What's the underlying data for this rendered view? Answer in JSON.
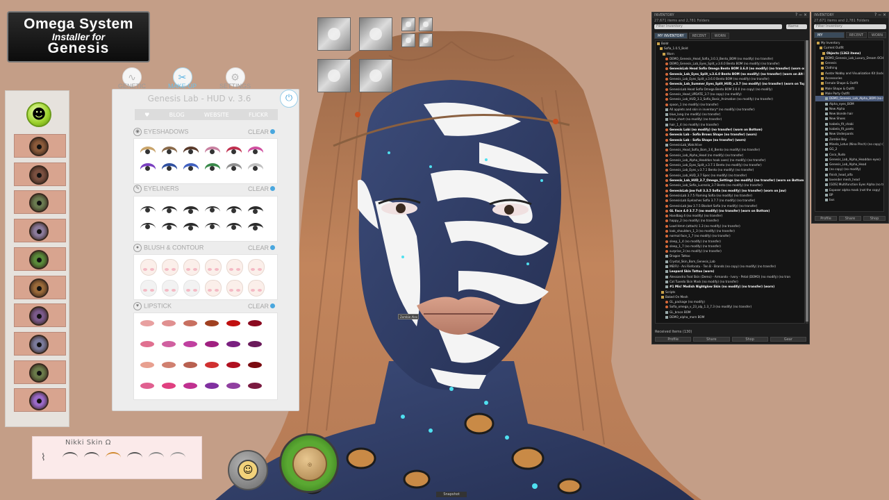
{
  "logo": {
    "line1": "Omega System",
    "line2": "Installer for",
    "line3": "Genesis"
  },
  "eye_swatches": [
    "#8a5a3a",
    "#7a5040",
    "#6a7a50",
    "#8a7a9a",
    "#5a8a3a",
    "#9a6a3a",
    "#7a5a8a",
    "#7a7a9a",
    "#6a7a4a",
    "#9a6ac8"
  ],
  "hud": {
    "tabs": [
      {
        "label": "GENETIC",
        "icon": "dna-icon",
        "glyph": "∿"
      },
      {
        "label": "MAKE-UP",
        "icon": "makeup-icon",
        "glyph": "✂"
      },
      {
        "label": "SETTINGS",
        "icon": "settings-icon",
        "glyph": "⚙"
      }
    ],
    "title": "Genesis Lab - HUD v. 3.6",
    "nav": [
      "♥",
      "BLOG",
      "WEBSITE",
      "FLICKR"
    ],
    "sections": [
      {
        "label": "EYESHADOWS",
        "clear": "CLEAR"
      },
      {
        "label": "EYELINERS",
        "clear": "CLEAR"
      },
      {
        "label": "BLUSH & CONTOUR",
        "clear": "CLEAR"
      },
      {
        "label": "LIPSTICK",
        "clear": "CLEAR"
      }
    ],
    "eyeshadow_colors": [
      "#c9a46a",
      "#8a6a4a",
      "#5a3a2a",
      "#c880a0",
      "#c03050",
      "#d050a0",
      "#7a40c0",
      "#3050a0",
      "#4060c0",
      "#3a8a4a",
      "#909090",
      "#c0c0c0"
    ],
    "lipstick_colors": [
      "#e8a0a0",
      "#e09090",
      "#c87060",
      "#a04020",
      "#c01010",
      "#8a0a20",
      "#e07090",
      "#d060a0",
      "#c040a0",
      "#a02080",
      "#7a2080",
      "#6a1a5a",
      "#e8a090",
      "#d08070",
      "#b86050",
      "#d03030",
      "#b01020",
      "#7a0a10",
      "#e06090",
      "#e04080",
      "#c03090",
      "#8030a0",
      "#9040a0",
      "#7a1a40"
    ]
  },
  "nikki": {
    "title": "Nikki Skin Ω"
  },
  "inventory_left": {
    "title": "INVENTORY",
    "count": "27,671 items and 2,781 Folders",
    "filter_placeholder": "Filter Inventory",
    "filter_option": "Name",
    "tabs": [
      "MY INVENTORY",
      "RECENT",
      "WORN"
    ],
    "items": [
      {
        "t": "Boldr",
        "k": "folder",
        "b": false
      },
      {
        "t": "Sofia_1.0.5_Bold",
        "k": "folder",
        "b": false
      },
      {
        "t": "Worn",
        "k": "folder",
        "b": false
      },
      {
        "t": "DEMO_Genesis_Head_Sofia_3.0.3_Bento_BOM (no modify) (no transfer)",
        "k": "obj",
        "b": false
      },
      {
        "t": "DEMO_Genesis_Lab_Eyes_Split_v.3.6.0 Bento BOM (no modify) (no transfer)",
        "k": "obj",
        "b": false
      },
      {
        "t": "GenesisLab Head Sofia Omega Bento BOM 3.6.0 (no modify) (no transfer) (worn on",
        "k": "obj",
        "b": true
      },
      {
        "t": "Genesis_Lab_Eyes_Split_v.3.6.0 Bento BOM (no modify) (no transfer) (worn on Alt Lef",
        "k": "obj",
        "b": true
      },
      {
        "t": "Genesis_Lab_Eyes_Split_v.3.6.0 Bento BOM (no modify) (no transfer)",
        "k": "obj",
        "b": false
      },
      {
        "t": "Genesis_Lab_Summer_Eyes_Split_HUD_v.3.7 (no modify) (no transfer) (worn on Top I",
        "k": "obj",
        "b": true
      },
      {
        "t": "GenesisLab Head Sofia Omega Bento BOM 3.6.0 (no copy) (no modify)",
        "k": "obj",
        "b": false
      },
      {
        "t": "Genesis_Head_UPDATE_3.7 (no copy) (no modify)",
        "k": "obj",
        "b": false
      },
      {
        "t": "Genesis_Lab_HUD_3.3_Sofia_Basic_Animation (no modify) (no transfer)",
        "k": "obj",
        "b": false
      },
      {
        "t": "spoon_1 (no modify) (no transfer)",
        "k": "obj",
        "b": false
      },
      {
        "t": "All applets and skin in inventory* (no modify) (no transfer)",
        "k": "cloth",
        "b": false
      },
      {
        "t": "blue_long (no modify) (no transfer)",
        "k": "cloth",
        "b": false
      },
      {
        "t": "blue_short (no modify) (no transfer)",
        "k": "cloth",
        "b": false
      },
      {
        "t": "hair_1_4 (no modify) (no transfer)",
        "k": "cloth",
        "b": false
      },
      {
        "t": "Genesis Lobi (no modify) (no transfer) (worn on Bottom)",
        "k": "obj",
        "b": true
      },
      {
        "t": "Genesis Lab - Sofia Brows Shape (no transfer) (worn)",
        "k": "obj",
        "b": true
      },
      {
        "t": "Genesis Lab - Sofia Shape (no transfer) (worn)",
        "k": "obj",
        "b": true
      },
      {
        "t": "GenesisLab_Watchlive",
        "k": "cloth",
        "b": false
      },
      {
        "t": "Genesis_Head_Sofia_Bom_3.6_Bento (no modify) (no transfer)",
        "k": "obj",
        "b": false
      },
      {
        "t": "Genesis_Lab_Alpha_Head (no modify) (no transfer)",
        "k": "obj",
        "b": false
      },
      {
        "t": "Genesis_Lab_Alpha_Headdon hook axes) (no modify) (no transfer)",
        "k": "obj",
        "b": false
      },
      {
        "t": "Genesis_Lab_Eyes_Split_v.3.7.1 Bento (no modify) (no transfer)",
        "k": "obj",
        "b": false
      },
      {
        "t": "Genesis_Lab_Eyes_v.3.7.1 Bento (no modify) (no transfer)",
        "k": "obj",
        "b": false
      },
      {
        "t": "Genesis_Lab_HUD_3.7 Spec (no modify) (no transfer)",
        "k": "obj",
        "b": false
      },
      {
        "t": "Genesis_Lab_HUD_3.7_Omega_Settings (no modify) (no transfer) (worn on Bottom R",
        "k": "obj",
        "b": true
      },
      {
        "t": "Genesis_Lab_Sofia_Lucrezia_3.7 Bento (no modify) (no transfer)",
        "k": "obj",
        "b": false
      },
      {
        "t": "GenesisLab Jaw Full 3.3.5 Sofia (no modify) (no transfer) (worn on Jaw)",
        "k": "obj",
        "b": true
      },
      {
        "t": "GenesisLab 3.7.5 Flaming Sofia (no modify) (no transfer)",
        "k": "obj",
        "b": false
      },
      {
        "t": "GenesisLab Eyelashes Sofia 3.7.7 (no modify) (no transfer)",
        "k": "obj",
        "b": false
      },
      {
        "t": "GenesisLab Jaw 3.7.5 Blocket Sofia (no modify) (no transfer)",
        "k": "obj",
        "b": false
      },
      {
        "t": "GL Face 4.0 3.7.7 (no modify) (no transfer) (worn on Bottom)",
        "k": "obj",
        "b": true
      },
      {
        "t": "Handbag 4 (no modify) (no transfer)",
        "k": "obj",
        "b": false
      },
      {
        "t": "happy_2 (no modify) (no transfer)",
        "k": "obj",
        "b": false
      },
      {
        "t": "Load Hmm (attach) 1.3 (no modify) (no transfer)",
        "k": "obj",
        "b": false
      },
      {
        "t": "look_shoulders_1_3 (no modify) (no transfer)",
        "k": "obj",
        "b": false
      },
      {
        "t": "normal face_1_7 (no modify) (no transfer)",
        "k": "obj",
        "b": false
      },
      {
        "t": "sleep_1_4 (no modify) (no transfer)",
        "k": "obj",
        "b": false
      },
      {
        "t": "sleep_1_7 (no modify) (no transfer)",
        "k": "obj",
        "b": false
      },
      {
        "t": "surprise_3 (no modify) (no transfer)",
        "k": "obj",
        "b": false
      },
      {
        "t": "Dragon Tattoo",
        "k": "cloth",
        "b": false
      },
      {
        "t": "Crystal_Skin_Bom_Genesis_Lab",
        "k": "cloth",
        "b": false
      },
      {
        "t": "MEIFU - Ani Rieforatu - Ten B - Brands (no copy) (no modify) (no transfer)",
        "k": "cloth",
        "b": false
      },
      {
        "t": "Leopard Skin Tattoo (worn)",
        "k": "cloth",
        "b": true
      },
      {
        "t": "Alessandra Feat Skin (Demo) - Armando - Ivory - Petal (DEMO) (no modify) (no tran",
        "k": "cloth",
        "b": false
      },
      {
        "t": "Cat Tuxedo Skin Mask (no modify) (no transfer)",
        "k": "cloth",
        "b": false
      },
      {
        "t": "#1 Mis! Modish Nightglow Skin (no modify) (no transfer) (worn)",
        "k": "cloth",
        "b": true
      },
      {
        "t": "Scripts",
        "k": "folder",
        "b": false
      },
      {
        "t": "Baked On Mesh",
        "k": "folder",
        "b": false
      },
      {
        "t": "GL_package (no modify)",
        "k": "obj",
        "b": false
      },
      {
        "t": "Sofia_omega_v_23_alp_1.3_7.3 (no modify) (no transfer)",
        "k": "obj",
        "b": false
      },
      {
        "t": "GL_brace BOM",
        "k": "cloth",
        "b": false
      },
      {
        "t": "DEMO_alpha_mom BOM",
        "k": "cloth",
        "b": false
      }
    ],
    "status": "Received Items (130)",
    "buttons": [
      "Profile",
      "Share",
      "Shop",
      "Gear"
    ]
  },
  "inventory_right": {
    "title": "INVENTORY",
    "count": "27,671 items and 2,781 Folders",
    "filter_placeholder": "Filter Inventory",
    "tabs": [
      "MY INVENTORY",
      "RECENT",
      "WORN"
    ],
    "items": [
      {
        "t": "My Inventory",
        "k": "folder",
        "b": false
      },
      {
        "t": "Current Outfit",
        "k": "folder",
        "b": false
      },
      {
        "t": "Objects (1363 items)",
        "k": "folder",
        "b": true
      },
      {
        "t": "DEMO_Genesis_Lab_Luxury_Dream OCHA",
        "k": "folder",
        "b": false
      },
      {
        "t": "Genesis",
        "k": "folder",
        "b": false
      },
      {
        "t": "Clothing",
        "k": "folder",
        "b": false
      },
      {
        "t": "Avatar Nobby and Visualization Kit (locked)",
        "k": "folder",
        "b": false
      },
      {
        "t": "Accessories",
        "k": "folder",
        "b": false
      },
      {
        "t": "Female Shape & Outfit",
        "k": "folder",
        "b": false
      },
      {
        "t": "Male Shape & Outfit",
        "k": "folder",
        "b": false
      },
      {
        "t": "Male Party Outfit",
        "k": "folder",
        "b": false
      },
      {
        "t": "DEMO_Genesis_Lab_Alpha_BOM (no modify)",
        "k": "cloth",
        "b": false
      },
      {
        "t": "Alpha_eyes_BOM",
        "k": "cloth",
        "b": false
      },
      {
        "t": "New Alpha",
        "k": "cloth",
        "b": false
      },
      {
        "t": "New blonde hair",
        "k": "cloth",
        "b": false
      },
      {
        "t": "New Shoes",
        "k": "cloth",
        "b": false
      },
      {
        "t": "Isabela_fit_shabi",
        "k": "cloth",
        "b": false
      },
      {
        "t": "Isabela_fit_pants",
        "k": "cloth",
        "b": false
      },
      {
        "t": "New Underpants",
        "k": "cloth",
        "b": false
      },
      {
        "t": "Zombie Boy",
        "k": "cloth",
        "b": false
      },
      {
        "t": "Minela_Lotus (Nina Pinch) (no copy) (no modify)",
        "k": "cloth",
        "b": false
      },
      {
        "t": "GG_2",
        "k": "cloth",
        "b": false
      },
      {
        "t": "Coco_Rudo",
        "k": "cloth",
        "b": false
      },
      {
        "t": "Genesis_Lab_Alpha_Headdon eyes)",
        "k": "cloth",
        "b": false
      },
      {
        "t": "Genesis_Lab_Alpha_Head",
        "k": "cloth",
        "b": false
      },
      {
        "t": "(no copy) (no modify)",
        "k": "cloth",
        "b": false
      },
      {
        "t": "finish_head_alfa",
        "k": "cloth",
        "b": false
      },
      {
        "t": "lavender mesh_head",
        "k": "cloth",
        "b": false
      },
      {
        "t": "[GOS] Multifunction Eyes Alpha (no transfer)",
        "k": "cloth",
        "b": false
      },
      {
        "t": "Exposer alpha mask (not the copy)",
        "k": "cloth",
        "b": false
      },
      {
        "t": "BP",
        "k": "cloth",
        "b": false
      },
      {
        "t": "bus",
        "k": "cloth",
        "b": false
      }
    ],
    "buttons": [
      "Profile",
      "Share",
      "Shop"
    ]
  },
  "tooltip": "Zombie Alex",
  "bottom_bar": "Snapshot"
}
